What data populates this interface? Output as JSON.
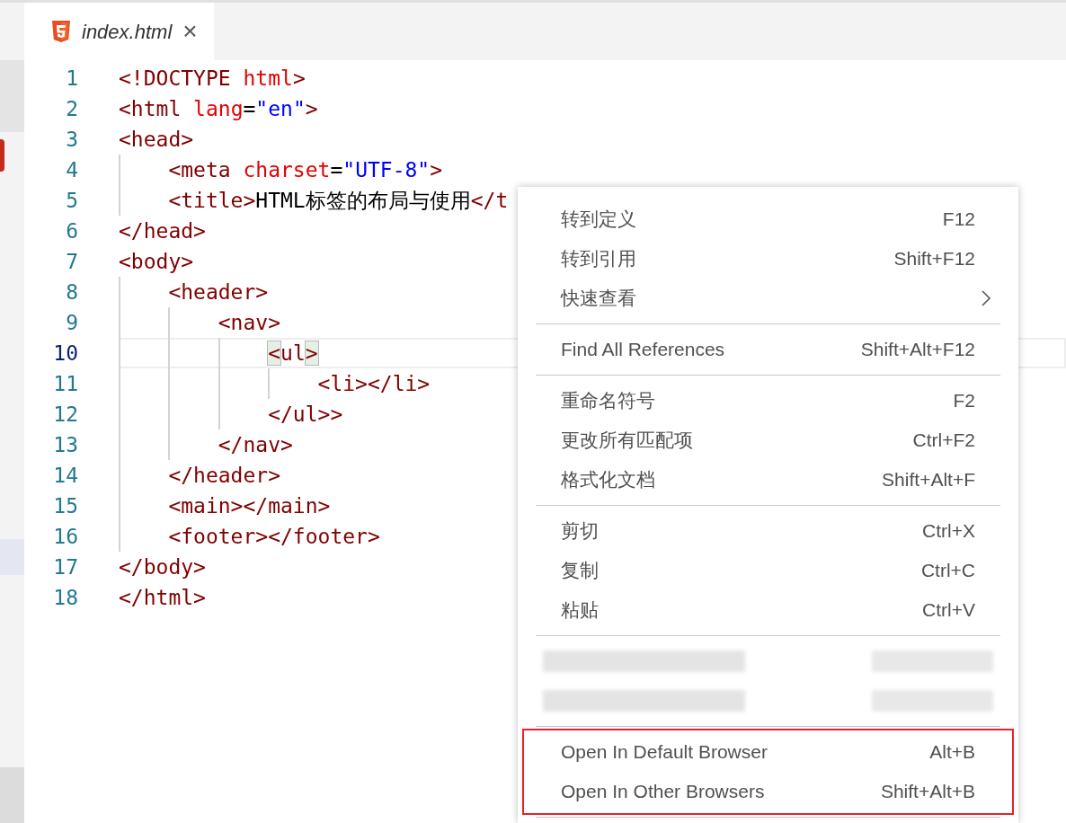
{
  "tab": {
    "title": "index.html",
    "selected": true,
    "close": "×"
  },
  "editor": {
    "lines": [
      {
        "number": "1",
        "current": false,
        "tokens": [
          {
            "kind": "tag",
            "text": "<!DOCTYPE "
          },
          {
            "kind": "attr",
            "text": "html"
          },
          {
            "kind": "tag",
            "text": ">"
          }
        ]
      },
      {
        "number": "2",
        "current": false,
        "tokens": [
          {
            "kind": "tag",
            "text": "<html "
          },
          {
            "kind": "attr",
            "text": "lang"
          },
          {
            "kind": "text",
            "text": "="
          },
          {
            "kind": "string",
            "text": "\"en\""
          },
          {
            "kind": "tag",
            "text": ">"
          }
        ]
      },
      {
        "number": "3",
        "current": false,
        "tokens": [
          {
            "kind": "tag",
            "text": "<head>"
          }
        ]
      },
      {
        "number": "4",
        "current": false,
        "tokens": [
          {
            "kind": "tag",
            "text": "    <meta "
          },
          {
            "kind": "attr",
            "text": "charset"
          },
          {
            "kind": "text",
            "text": "="
          },
          {
            "kind": "string",
            "text": "\"UTF-8\""
          },
          {
            "kind": "tag",
            "text": ">"
          }
        ]
      },
      {
        "number": "5",
        "current": false,
        "tokens": [
          {
            "kind": "tag",
            "text": "    <title>"
          },
          {
            "kind": "text",
            "text": "HTML标签的布局与使用"
          },
          {
            "kind": "tag",
            "text": "</t"
          }
        ]
      },
      {
        "number": "6",
        "current": false,
        "tokens": [
          {
            "kind": "tag",
            "text": "</head>"
          }
        ]
      },
      {
        "number": "7",
        "current": false,
        "tokens": [
          {
            "kind": "tag",
            "text": "<body>"
          }
        ]
      },
      {
        "number": "8",
        "current": false,
        "tokens": [
          {
            "kind": "tag",
            "text": "    <header>"
          }
        ]
      },
      {
        "number": "9",
        "current": false,
        "tokens": [
          {
            "kind": "tag",
            "text": "        <nav>"
          }
        ]
      },
      {
        "number": "10",
        "current": true,
        "tokens": [
          {
            "kind": "bracket",
            "text": "            <"
          },
          {
            "kind": "tag",
            "text": "ul"
          },
          {
            "kind": "bracket",
            "text": ">"
          }
        ]
      },
      {
        "number": "11",
        "current": false,
        "tokens": [
          {
            "kind": "tag",
            "text": "                <li></li>"
          }
        ]
      },
      {
        "number": "12",
        "current": false,
        "tokens": [
          {
            "kind": "tag",
            "text": "            </ul>>"
          }
        ]
      },
      {
        "number": "13",
        "current": false,
        "tokens": [
          {
            "kind": "tag",
            "text": "        </nav>"
          }
        ]
      },
      {
        "number": "14",
        "current": false,
        "tokens": [
          {
            "kind": "tag",
            "text": "    </header>"
          }
        ]
      },
      {
        "number": "15",
        "current": false,
        "tokens": [
          {
            "kind": "tag",
            "text": "    <main></main>"
          }
        ]
      },
      {
        "number": "16",
        "current": false,
        "tokens": [
          {
            "kind": "tag",
            "text": "    <footer></footer>"
          }
        ]
      },
      {
        "number": "17",
        "current": false,
        "tokens": [
          {
            "kind": "tag",
            "text": "</body>"
          }
        ]
      },
      {
        "number": "18",
        "current": false,
        "tokens": [
          {
            "kind": "tag",
            "text": "</html>"
          }
        ]
      }
    ]
  },
  "context_menu": {
    "groups": [
      {
        "marked": false,
        "items": [
          {
            "kind": "item",
            "label": "转到定义",
            "shortcut": "F12"
          },
          {
            "kind": "item",
            "label": "转到引用",
            "shortcut": "Shift+F12"
          },
          {
            "kind": "submenu",
            "label": "快速查看"
          }
        ]
      },
      {
        "marked": false,
        "items": [
          {
            "kind": "item",
            "label": "Find All References",
            "shortcut": "Shift+Alt+F12"
          }
        ]
      },
      {
        "marked": false,
        "items": [
          {
            "kind": "item",
            "label": "重命名符号",
            "shortcut": "F2"
          },
          {
            "kind": "item",
            "label": "更改所有匹配项",
            "shortcut": "Ctrl+F2"
          },
          {
            "kind": "item",
            "label": "格式化文档",
            "shortcut": "Shift+Alt+F"
          }
        ]
      },
      {
        "marked": false,
        "items": [
          {
            "kind": "item",
            "label": "剪切",
            "shortcut": "Ctrl+X"
          },
          {
            "kind": "item",
            "label": "复制",
            "shortcut": "Ctrl+C"
          },
          {
            "kind": "item",
            "label": "粘贴",
            "shortcut": "Ctrl+V"
          }
        ]
      },
      {
        "marked": false,
        "items": [
          {
            "kind": "redacted"
          },
          {
            "kind": "redacted"
          }
        ]
      },
      {
        "marked": true,
        "items": [
          {
            "kind": "item",
            "label": "Open In Default Browser",
            "shortcut": "Alt+B"
          },
          {
            "kind": "item",
            "label": "Open In Other Browsers",
            "shortcut": "Shift+Alt+B"
          }
        ]
      }
    ]
  }
}
